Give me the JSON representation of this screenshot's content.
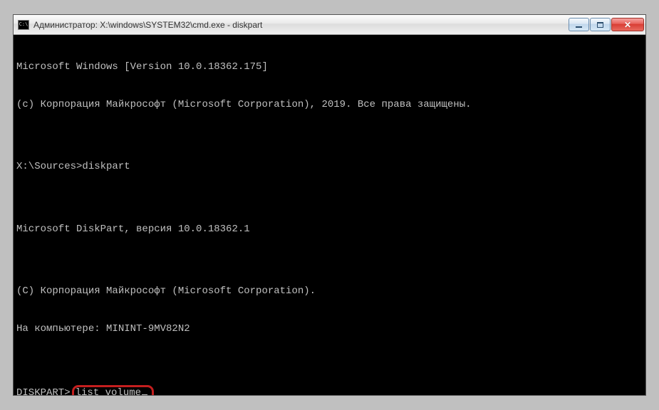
{
  "titlebar": {
    "icon_label": "C:\\",
    "title": "Администратор: X:\\windows\\SYSTEM32\\cmd.exe - diskpart"
  },
  "controls": {
    "minimize": "minimize",
    "maximize": "maximize",
    "close": "close"
  },
  "terminal": {
    "line1": "Microsoft Windows [Version 10.0.18362.175]",
    "line2": "(c) Корпорация Майкрософт (Microsoft Corporation), 2019. Все права защищены.",
    "blank1": "",
    "line3": "X:\\Sources>diskpart",
    "blank2": "",
    "line4": "Microsoft DiskPart, версия 10.0.18362.1",
    "blank3": "",
    "line5": "(C) Корпорация Майкрософт (Microsoft Corporation).",
    "line6": "На компьютере: MININT-9MV82N2",
    "blank4": "",
    "prompt": "DISKPART>",
    "command": "list volume"
  }
}
